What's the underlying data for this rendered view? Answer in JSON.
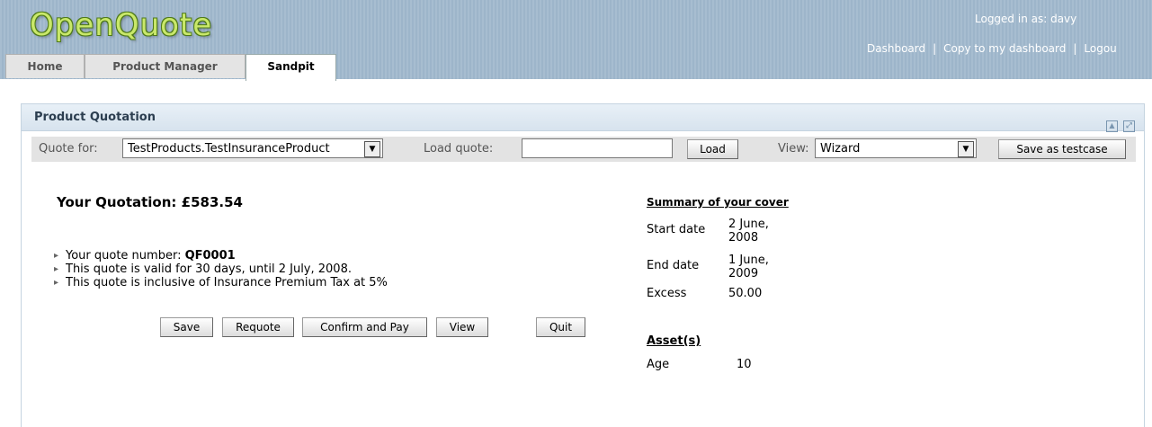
{
  "app": {
    "logo": "OpenQuote"
  },
  "header": {
    "logged_in": "Logged in as: davy",
    "links": [
      "Dashboard",
      "Copy to my dashboard",
      "Logou"
    ],
    "tabs": [
      "Home",
      "Product Manager",
      "Sandpit"
    ],
    "active_tab": "Sandpit"
  },
  "panel": {
    "title": "Product Quotation"
  },
  "toolbar": {
    "quote_for_label": "Quote for:",
    "quote_for_value": "TestProducts.TestInsuranceProduct",
    "load_quote_label": "Load quote:",
    "load_quote_value": "",
    "load_button": "Load",
    "view_label": "View:",
    "view_value": "Wizard",
    "save_testcase_button": "Save as testcase"
  },
  "quotation": {
    "title": "Your Quotation: £583.54",
    "quote_number_label": "Your quote number: ",
    "quote_number": "QF0001",
    "validity": "This quote is valid for 30 days, until 2 July, 2008.",
    "tax_note": "This quote is inclusive of Insurance Premium Tax at 5%"
  },
  "actions": [
    "Save",
    "Requote",
    "Confirm and Pay",
    "View",
    "Quit"
  ],
  "summary": {
    "heading": "Summary of your cover",
    "rows": [
      {
        "label": "Start date",
        "value_line1": "2 June,",
        "value_line2": "2008"
      },
      {
        "label": "End date",
        "value_line1": "1 June,",
        "value_line2": "2009"
      },
      {
        "label": "Excess",
        "value_line1": "50.00",
        "value_line2": ""
      }
    ]
  },
  "assets": {
    "heading": "Asset(s)",
    "rows": [
      {
        "label": "Age",
        "value": "10"
      }
    ]
  },
  "colors": {
    "header_bg": "#a7bdd0",
    "logo_green": "#c9e86a",
    "panel_title_bg": "#dfe9f2"
  }
}
